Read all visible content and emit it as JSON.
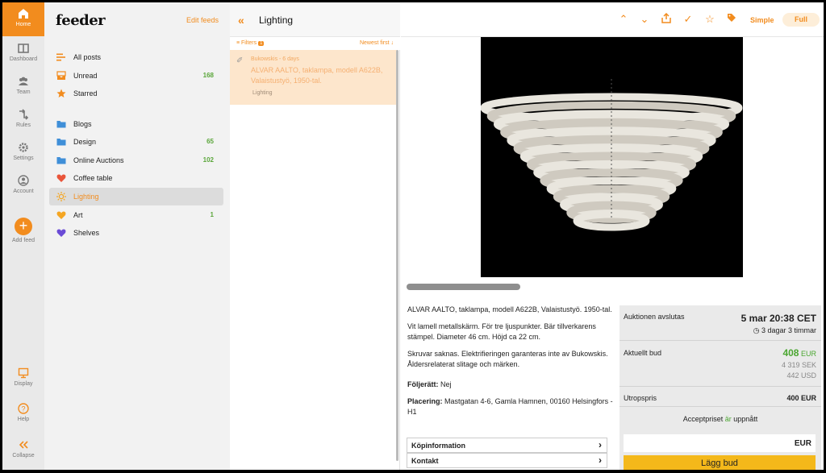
{
  "rail": {
    "home": "Home",
    "dashboard": "Dashboard",
    "team": "Team",
    "rules": "Rules",
    "settings": "Settings",
    "account": "Account",
    "add_feed": "Add feed",
    "display": "Display",
    "help": "Help",
    "collapse": "Collapse"
  },
  "feeds": {
    "logo": "feeder",
    "edit_feeds": "Edit feeds",
    "items": [
      {
        "label": "All posts",
        "count": "",
        "icon": "list-icon"
      },
      {
        "label": "Unread",
        "count": "168",
        "icon": "inbox-icon"
      },
      {
        "label": "Starred",
        "count": "",
        "icon": "star-icon"
      },
      {
        "label": "Blogs",
        "count": "",
        "icon": "folder-icon"
      },
      {
        "label": "Design",
        "count": "65",
        "icon": "folder-icon"
      },
      {
        "label": "Online Auctions",
        "count": "102",
        "icon": "folder-icon"
      },
      {
        "label": "Coffee table",
        "count": "",
        "icon": "heart-icon"
      },
      {
        "label": "Lighting",
        "count": "",
        "icon": "sun-icon"
      },
      {
        "label": "Art",
        "count": "1",
        "icon": "heart-icon"
      },
      {
        "label": "Shelves",
        "count": "",
        "icon": "heart-icon"
      }
    ],
    "active": "Lighting"
  },
  "entries": {
    "title": "Lighting",
    "filters": "Filters",
    "filters_count": "1",
    "sort": "Newest first ↓",
    "card": {
      "source": "Bukowskis - 6 days",
      "title": "ALVAR AALTO, taklampa, modell A622B, Valaistustyö, 1950-tal.",
      "tag": "Lighting"
    }
  },
  "article": {
    "mode_simple": "Simple",
    "mode_full": "Full",
    "paragraphs": [
      "ALVAR AALTO, taklampa, modell A622B, Valaistustyö. 1950-tal.",
      "Vit lamell metallskärm. För tre ljuspunkter. Bär tillverkarens stämpel. Diameter 46 cm. Höjd ca 22 cm.",
      "Skruvar saknas. Elektrifieringen garanteras inte av Bukowskis. Åldersrelaterat slitage och märken."
    ],
    "copyright_label": "Följerätt:",
    "copyright_value": "Nej",
    "location_label": "Placering:",
    "location_value": "Mastgatan 4-6, Gamla Hamnen, 00160 Helsingfors - H1",
    "accordion": [
      "Köpinformation",
      "Kontakt"
    ]
  },
  "bid": {
    "ends_label": "Auktionen avslutas",
    "ends_date": "5 mar 20:38 CET",
    "ends_remaining": "3 dagar 3 timmar",
    "current_label": "Aktuellt bud",
    "current_value": "408",
    "current_ccy": "EUR",
    "current_sek": "4 319 SEK",
    "current_usd": "442 USD",
    "start_label": "Utropspris",
    "start_value": "400 EUR",
    "reserve_pre": "Acceptpriset",
    "reserve_mid": "är",
    "reserve_post": "uppnått",
    "amount_ccy": "EUR",
    "button": "Lägg bud"
  },
  "colors": {
    "accent": "#f28c1e",
    "count_green": "#5aa63a",
    "bid_button": "#f4b81a"
  }
}
